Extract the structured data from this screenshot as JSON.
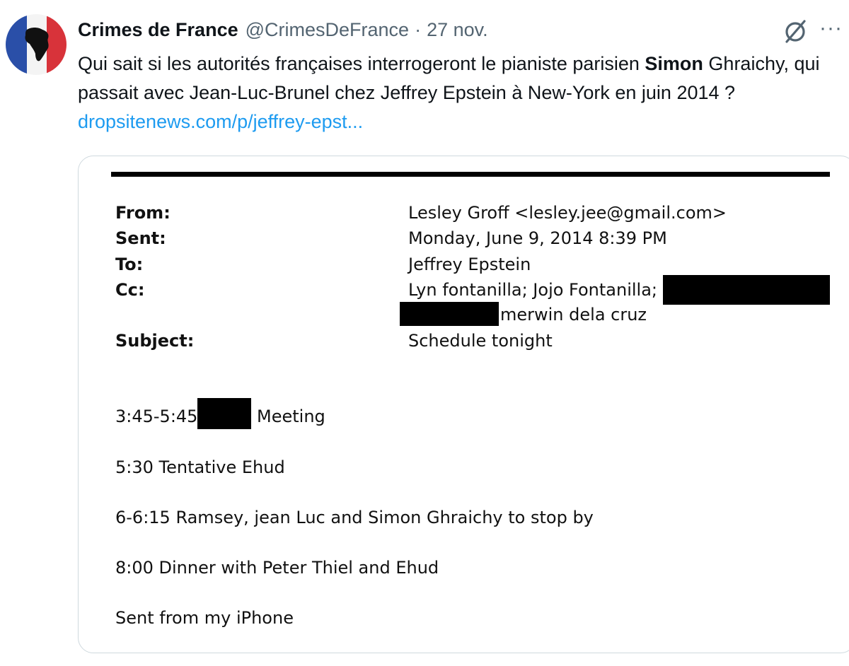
{
  "tweet": {
    "author_name": "Crimes de France",
    "handle": "@CrimesDeFrance",
    "separator": "·",
    "date": "27 nov.",
    "more_label": "···",
    "text_part1": "Qui sait si les autorités françaises interrogeront le pianiste parisien ",
    "text_bold": "Simon",
    "text_part2": " Ghraichy, qui passait avec Jean-Luc-Brunel chez Jeffrey Epstein à New-York en juin 2014 ? ",
    "link_text": "dropsitenews.com/p/jeffrey-epst..."
  },
  "email": {
    "from_label": "From:",
    "from_value": "Lesley Groff <lesley.jee@gmail.com>",
    "sent_label": "Sent:",
    "sent_value": "Monday, June 9, 2014 8:39 PM",
    "to_label": "To:",
    "to_value": "Jeffrey Epstein",
    "cc_label": "Cc:",
    "cc_value_line1": "Lyn fontanilla; Jojo Fontanilla;",
    "cc_value_line2": "merwin dela cruz",
    "subject_label": "Subject:",
    "subject_value": "Schedule tonight",
    "line1_time": "3:45-5:45",
    "line1_rest": "Meeting",
    "line2": "5:30 Tentative Ehud",
    "line3": "6-6:15 Ramsey, jean Luc and Simon Ghraichy to stop by",
    "line4": "8:00 Dinner with Peter Thiel and Ehud",
    "signature": "Sent from my iPhone"
  },
  "icons": {
    "avatar": "france-flag-africa-avatar",
    "grok": "grok-icon",
    "more": "more-icon"
  }
}
